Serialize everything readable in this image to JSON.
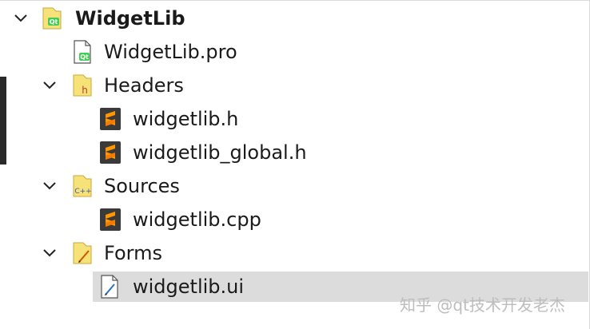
{
  "tree": {
    "root": {
      "label": "WidgetLib",
      "expanded": true,
      "icon": "qt-project-folder-icon"
    },
    "items": [
      {
        "label": "WidgetLib.pro",
        "icon": "qt-pro-file-icon"
      },
      {
        "label": "Headers",
        "icon": "headers-folder-icon",
        "expanded": true
      },
      {
        "label": "widgetlib.h",
        "icon": "sublime-file-icon"
      },
      {
        "label": "widgetlib_global.h",
        "icon": "sublime-file-icon"
      },
      {
        "label": "Sources",
        "icon": "cpp-sources-folder-icon",
        "expanded": true
      },
      {
        "label": "widgetlib.cpp",
        "icon": "sublime-file-icon"
      },
      {
        "label": "Forms",
        "icon": "forms-folder-icon",
        "expanded": true
      },
      {
        "label": "widgetlib.ui",
        "icon": "ui-form-file-icon",
        "selected": true
      }
    ]
  },
  "watermark": "知乎 @qt技术开发老杰",
  "colors": {
    "selection": "#dcdcdc",
    "folder": "#f7e27a",
    "sublime": "#ff9800",
    "qt_green": "#41cd52"
  }
}
